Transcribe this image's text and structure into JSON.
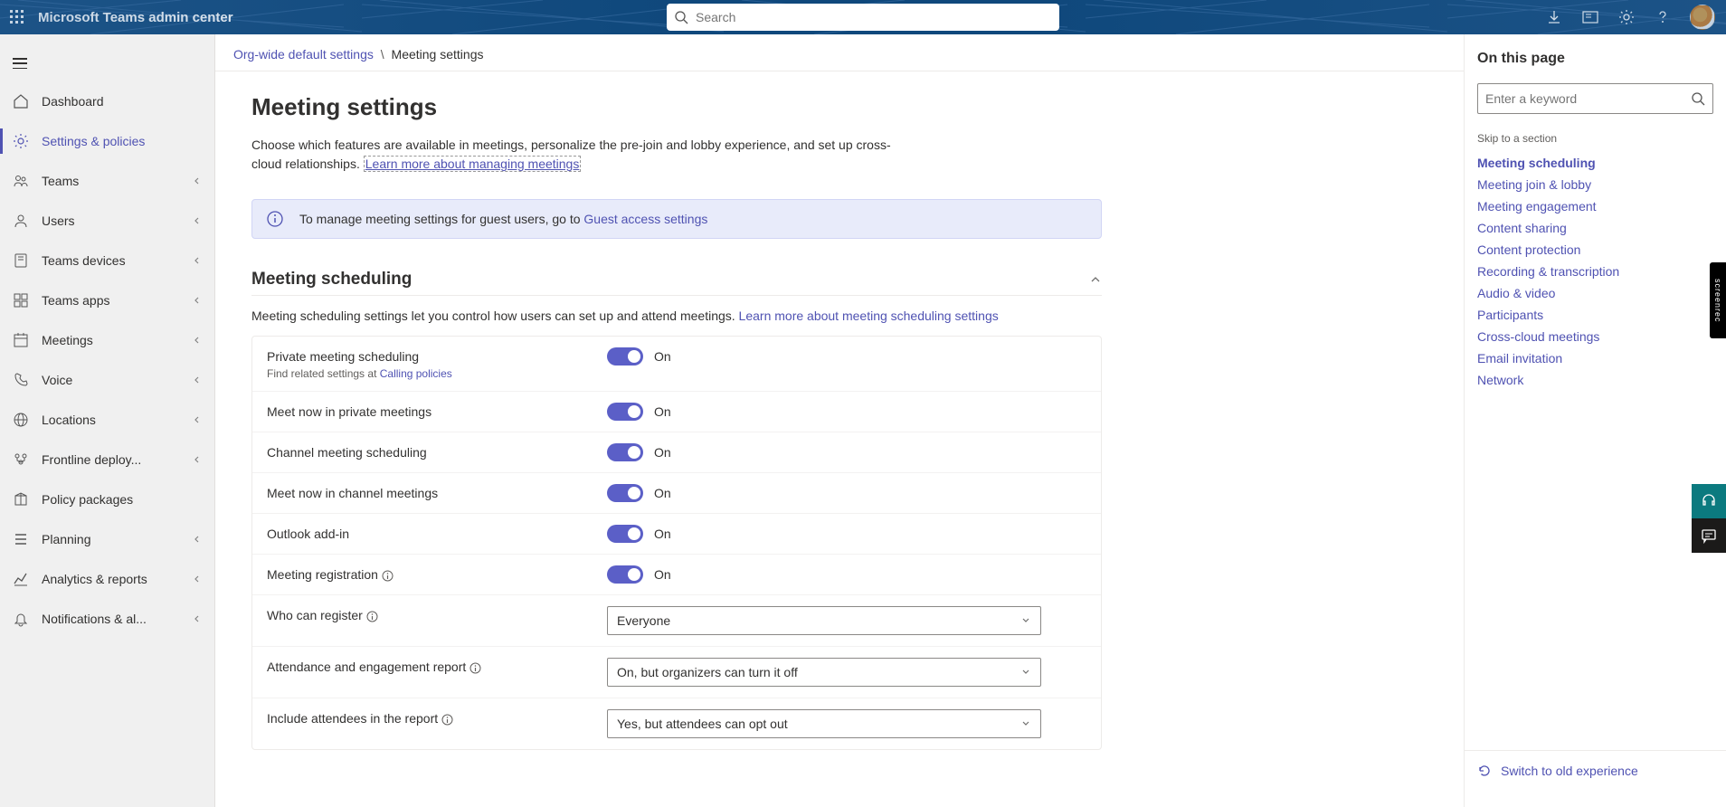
{
  "header": {
    "app_title": "Microsoft Teams admin center",
    "search_placeholder": "Search"
  },
  "sidebar": {
    "items": [
      {
        "label": "Dashboard",
        "icon": "home",
        "expandable": false,
        "active": false
      },
      {
        "label": "Settings & policies",
        "icon": "gear",
        "expandable": false,
        "active": true
      },
      {
        "label": "Teams",
        "icon": "team",
        "expandable": true,
        "active": false
      },
      {
        "label": "Users",
        "icon": "user",
        "expandable": true,
        "active": false
      },
      {
        "label": "Teams devices",
        "icon": "device",
        "expandable": true,
        "active": false
      },
      {
        "label": "Teams apps",
        "icon": "apps",
        "expandable": true,
        "active": false
      },
      {
        "label": "Meetings",
        "icon": "calendar",
        "expandable": true,
        "active": false
      },
      {
        "label": "Voice",
        "icon": "phone",
        "expandable": true,
        "active": false
      },
      {
        "label": "Locations",
        "icon": "globe",
        "expandable": true,
        "active": false
      },
      {
        "label": "Frontline deploy...",
        "icon": "frontline",
        "expandable": true,
        "active": false
      },
      {
        "label": "Policy packages",
        "icon": "package",
        "expandable": false,
        "active": false
      },
      {
        "label": "Planning",
        "icon": "plan",
        "expandable": true,
        "active": false
      },
      {
        "label": "Analytics & reports",
        "icon": "chart",
        "expandable": true,
        "active": false
      },
      {
        "label": "Notifications & al...",
        "icon": "bell",
        "expandable": true,
        "active": false
      }
    ]
  },
  "breadcrumb": {
    "parent": "Org-wide default settings",
    "current": "Meeting settings"
  },
  "page": {
    "title": "Meeting settings",
    "desc_prefix": "Choose which features are available in meetings, personalize the pre-join and lobby experience, and set up cross-cloud relationships. ",
    "desc_link": "Learn more about managing meetings",
    "banner_prefix": "To manage meeting settings for guest users, go to ",
    "banner_link": "Guest access settings"
  },
  "section": {
    "title": "Meeting scheduling",
    "desc_prefix": "Meeting scheduling settings let you control how users can set up and attend meetings. ",
    "desc_link": "Learn more about meeting scheduling settings"
  },
  "settings": [
    {
      "label": "Private meeting scheduling",
      "sub_prefix": "Find related settings at ",
      "sub_link": "Calling policies",
      "type": "toggle",
      "value": "On",
      "info": false
    },
    {
      "label": "Meet now in private meetings",
      "type": "toggle",
      "value": "On",
      "info": false
    },
    {
      "label": "Channel meeting scheduling",
      "type": "toggle",
      "value": "On",
      "info": false
    },
    {
      "label": "Meet now in channel meetings",
      "type": "toggle",
      "value": "On",
      "info": false
    },
    {
      "label": "Outlook add-in",
      "type": "toggle",
      "value": "On",
      "info": false
    },
    {
      "label": "Meeting registration",
      "type": "toggle",
      "value": "On",
      "info": true
    },
    {
      "label": "Who can register",
      "type": "select",
      "value": "Everyone",
      "info": true
    },
    {
      "label": "Attendance and engagement report",
      "type": "select",
      "value": "On, but organizers can turn it off",
      "info": true
    },
    {
      "label": "Include attendees in the report",
      "type": "select",
      "value": "Yes, but attendees can opt out",
      "info": true
    }
  ],
  "right": {
    "title": "On this page",
    "keyword_placeholder": "Enter a keyword",
    "skip_label": "Skip to a section",
    "toc": [
      {
        "label": "Meeting scheduling",
        "active": true
      },
      {
        "label": "Meeting join & lobby"
      },
      {
        "label": "Meeting engagement"
      },
      {
        "label": "Content sharing"
      },
      {
        "label": "Content protection"
      },
      {
        "label": "Recording & transcription"
      },
      {
        "label": "Audio & video"
      },
      {
        "label": "Participants"
      },
      {
        "label": "Cross-cloud meetings"
      },
      {
        "label": "Email invitation"
      },
      {
        "label": "Network"
      }
    ],
    "switch": "Switch to old experience"
  },
  "screenrec": "screenrec"
}
